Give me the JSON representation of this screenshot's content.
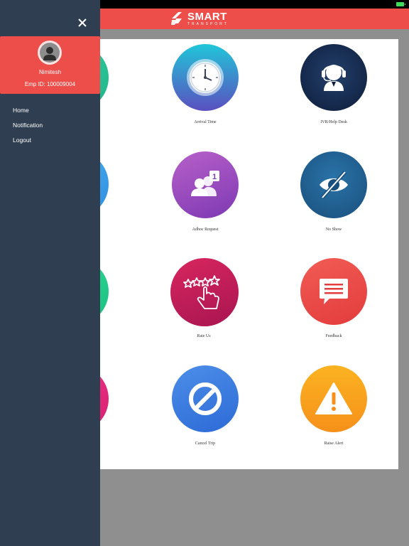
{
  "app": {
    "logo_text": "SMART",
    "logo_subtext": "TRANSPORT"
  },
  "drawer": {
    "close_icon": "close-icon",
    "user": {
      "name": "Nimitesh",
      "emp_id": "Emp ID: 100009004"
    },
    "menu": [
      {
        "label": "Home"
      },
      {
        "label": "Notification"
      },
      {
        "label": "Logout"
      }
    ]
  },
  "tiles": [
    {
      "label": "Arrival Time",
      "icon": "clock-icon"
    },
    {
      "label": "IVR/Help Desk",
      "icon": "headset-icon"
    },
    {
      "label": "Adhoc Request",
      "icon": "adhoc-users-icon"
    },
    {
      "label": "No Show",
      "icon": "eye-slash-icon"
    },
    {
      "label": "Rate Us",
      "icon": "rate-stars-icon"
    },
    {
      "label": "Feedback",
      "icon": "feedback-icon"
    },
    {
      "label": "Cancel Trip",
      "icon": "cancel-icon"
    },
    {
      "label": "Raise Alert",
      "icon": "alert-icon"
    }
  ],
  "colors": {
    "brand_red": "#ee4e4a",
    "drawer_bg": "#2f3e50",
    "overlay": "#8f8f8f"
  }
}
